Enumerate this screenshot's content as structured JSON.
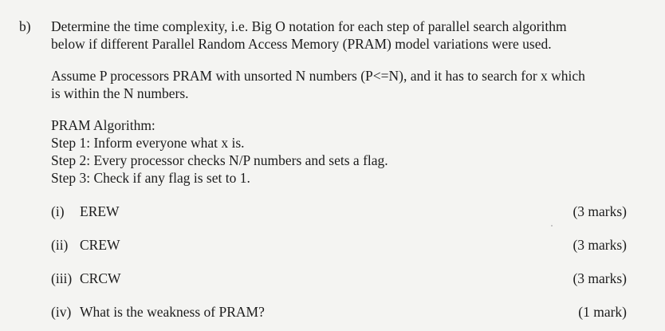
{
  "question": {
    "label": "b)",
    "intro_lines": [
      "Determine the time complexity, i.e. Big O notation for each step of parallel search algorithm",
      "below if different Parallel Random Access Memory (PRAM) model variations were used."
    ],
    "assumption_lines": [
      "Assume P processors PRAM with unsorted N numbers (P<=N), and it has to search for x which",
      "is within the N numbers."
    ],
    "algorithm": {
      "heading": "PRAM Algorithm:",
      "steps": [
        "Step 1: Inform everyone what x is.",
        "Step 2: Every processor checks N/P numbers and sets a flag.",
        "Step 3: Check if any flag is set to 1."
      ]
    },
    "subquestions": [
      {
        "number": "(i)",
        "text": "EREW",
        "marks": "(3 marks)"
      },
      {
        "number": "(ii)",
        "text": "CREW",
        "marks": "(3 marks)"
      },
      {
        "number": "(iii)",
        "text": "CRCW",
        "marks": "(3 marks)"
      },
      {
        "number": "(iv)",
        "text": "What is the weakness of PRAM?",
        "marks": "(1 mark)"
      }
    ]
  }
}
